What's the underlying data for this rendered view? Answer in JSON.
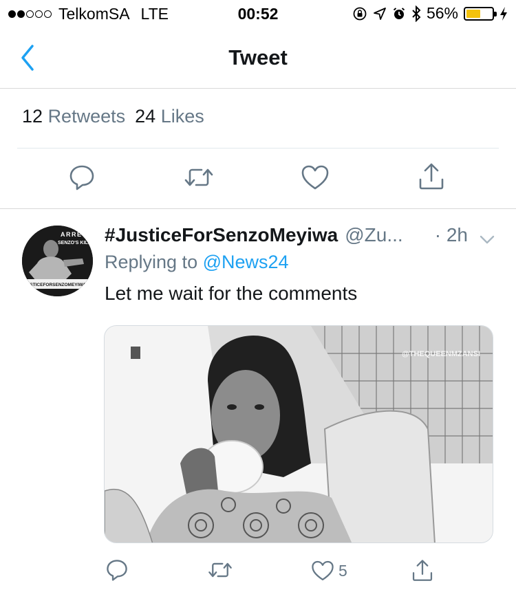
{
  "status_bar": {
    "carrier": "TelkomSA",
    "network": "LTE",
    "time": "00:52",
    "battery_percent": "56%",
    "battery_level": 0.56,
    "signal_bars_filled": 2,
    "signal_bars_total": 5
  },
  "nav": {
    "title": "Tweet",
    "back_icon": "chevron-left-icon"
  },
  "stats": {
    "retweets_count": "12",
    "retweets_label": "Retweets",
    "likes_count": "24",
    "likes_label": "Likes"
  },
  "main_actions": {
    "icons": [
      "reply-icon",
      "retweet-icon",
      "like-icon",
      "share-icon"
    ]
  },
  "reply": {
    "display_name": "#JusticeForSenzoMeyiwa",
    "handle": "@Zu...",
    "time": "· 2h",
    "replying_prefix": "Replying to",
    "replying_to": "@News24",
    "text": "Let me wait for the comments",
    "media_watermark": "@THEQUEENMZANSI",
    "like_count": "5",
    "avatar_lines": [
      "ARRE",
      "SENZO'S KILL",
      "JUSTICEFORSENZOMEYIWA"
    ]
  },
  "colors": {
    "accent": "#1da1f2",
    "muted": "#657786",
    "text": "#14171a",
    "battery": "#f4c20d"
  }
}
